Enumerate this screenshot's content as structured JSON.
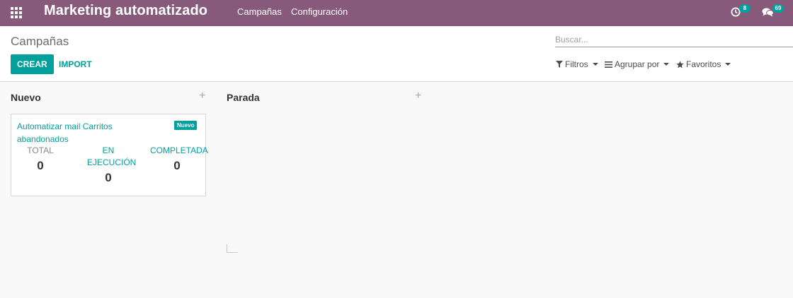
{
  "navbar": {
    "app_title": "Marketing automatizado",
    "menu": [
      "Campañas",
      "Configuración"
    ],
    "activity_count": "8",
    "messages_count": "69",
    "color": "#875a7b"
  },
  "control_panel": {
    "breadcrumb": "Campañas",
    "create_label": "CREAR",
    "import_label": "IMPORT",
    "search_placeholder": "Buscar...",
    "filters_label": "Filtros",
    "group_by_label": "Agrupar por",
    "favorites_label": "Favoritos"
  },
  "kanban": {
    "columns": [
      {
        "title": "Nuevo",
        "cards": [
          {
            "title": "Automatizar mail Carritos abandonados",
            "badge": "Nuevo",
            "stats": [
              {
                "label": "TOTAL",
                "value": "0"
              },
              {
                "label": "EN EJECUCIÓN",
                "value": "0"
              },
              {
                "label": "COMPLETADA",
                "value": "0"
              }
            ]
          }
        ]
      },
      {
        "title": "Parada",
        "cards": []
      }
    ]
  },
  "icons": {
    "apps": "apps-grid-icon",
    "activity": "clock-icon",
    "messages": "chat-bubbles-icon",
    "filter": "funnel-icon",
    "group": "bars-icon",
    "favorite": "star-icon",
    "add": "plus-icon"
  },
  "colors": {
    "accent": "#00a09d",
    "navbar": "#875a7b"
  }
}
